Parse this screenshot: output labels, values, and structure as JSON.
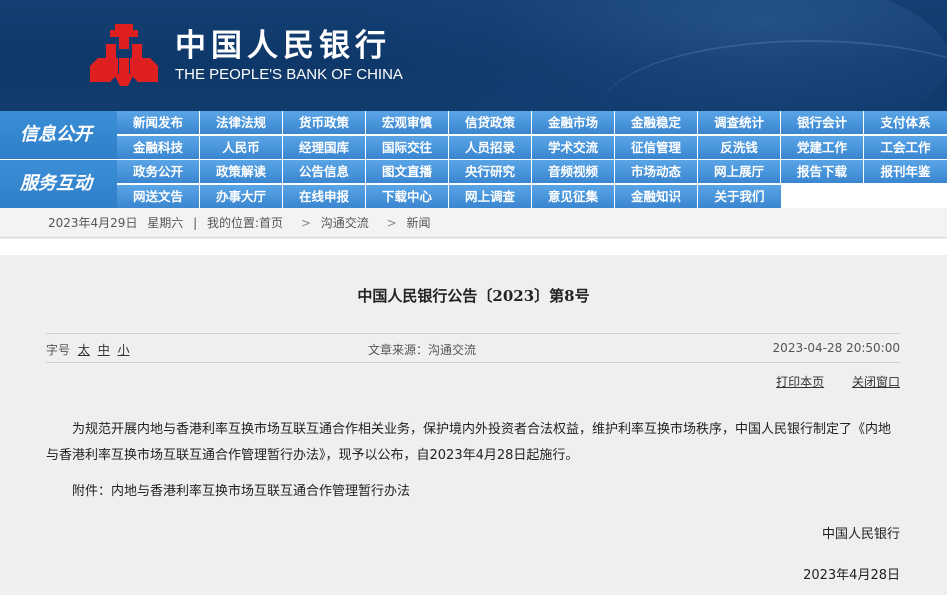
{
  "header": {
    "bank_name_cn": "中国人民银行",
    "bank_name_en": "THE PEOPLE'S BANK OF CHINA",
    "logo_icon": "pboc-logo-icon",
    "logo_color": "#e02020"
  },
  "nav": {
    "group1": {
      "title": "信息公开",
      "row1": [
        "新闻发布",
        "法律法规",
        "货币政策",
        "宏观审慎",
        "信贷政策",
        "金融市场",
        "金融稳定",
        "调查统计",
        "银行会计",
        "支付体系"
      ],
      "row2": [
        "金融科技",
        "人民币",
        "经理国库",
        "国际交往",
        "人员招录",
        "学术交流",
        "征信管理",
        "反洗钱",
        "党建工作",
        "工会工作"
      ]
    },
    "group2": {
      "title": "服务互动",
      "row1": [
        "政务公开",
        "政策解读",
        "公告信息",
        "图文直播",
        "央行研究",
        "音频视频",
        "市场动态",
        "网上展厅",
        "报告下载",
        "报刊年鉴"
      ],
      "row2": [
        "网送文告",
        "办事大厅",
        "在线申报",
        "下载中心",
        "网上调查",
        "意见征集",
        "金融知识",
        "关于我们"
      ]
    }
  },
  "breadcrumb": {
    "date": "2023年4月29日",
    "weekday": "星期六",
    "divider": "|",
    "location_label": "我的位置:",
    "home": "首页",
    "section": "沟通交流",
    "current": "新闻",
    "arrow": ">"
  },
  "article": {
    "title": "中国人民银行公告〔2023〕第8号",
    "font_size_label": "字号",
    "size_large": "太",
    "size_medium": "中",
    "size_small": "小",
    "source": "文章来源：沟通交流",
    "datetime": "2023-04-28 20:50:00",
    "print_label": "打印本页",
    "close_label": "关闭窗口",
    "paragraph": "为规范开展内地与香港利率互换市场互联互通合作相关业务，保护境内外投资者合法权益，维护利率互换市场秩序，中国人民银行制定了《内地与香港利率互换市场互联互通合作管理暂行办法》，现予以公布，自2023年4月28日起施行。",
    "attachment": "附件：内地与香港利率互换市场互联互通合作管理暂行办法",
    "signature": "中国人民银行",
    "sign_date": "2023年4月28日"
  }
}
